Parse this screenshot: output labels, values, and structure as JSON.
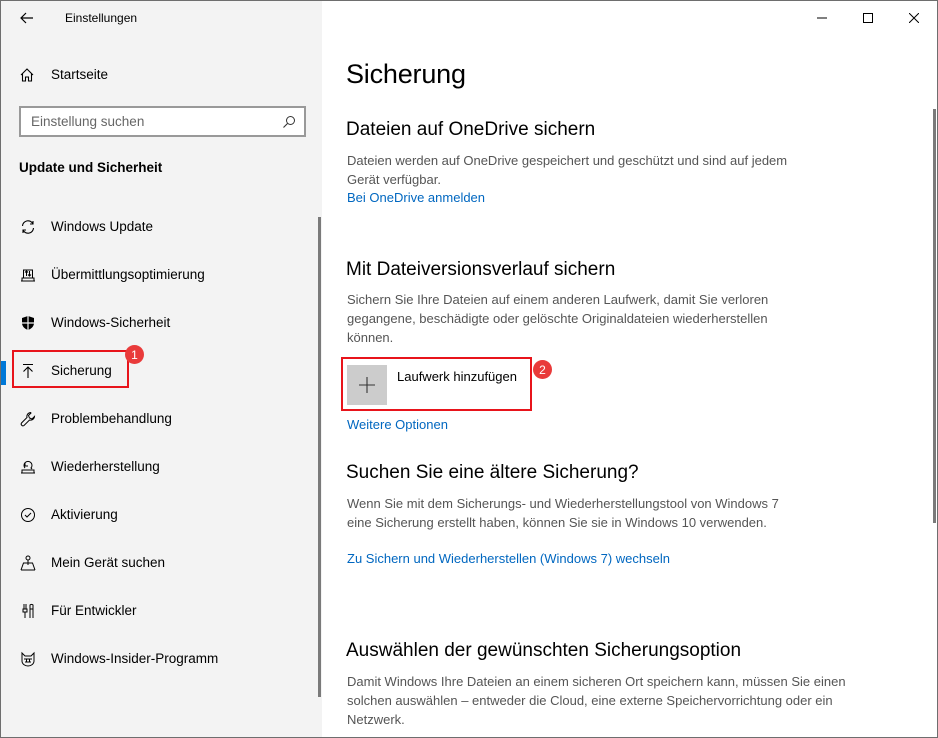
{
  "window": {
    "title": "Einstellungen",
    "controls": {
      "minimize_icon": "minimize-icon",
      "maximize_icon": "maximize-icon",
      "close_icon": "close-icon"
    }
  },
  "sidebar": {
    "back_icon": "back-arrow-icon",
    "home": {
      "label": "Startseite",
      "icon": "home-icon"
    },
    "search": {
      "placeholder": "Einstellung suchen",
      "value": "",
      "icon": "search-icon"
    },
    "section_title": "Update und Sicherheit",
    "items": [
      {
        "label": "Windows Update",
        "icon": "sync-icon",
        "active": false
      },
      {
        "label": "Übermittlungsoptimierung",
        "icon": "delivery-optimization-icon",
        "active": false
      },
      {
        "label": "Windows-Sicherheit",
        "icon": "shield-icon",
        "active": false
      },
      {
        "label": "Sicherung",
        "icon": "backup-upload-icon",
        "active": true
      },
      {
        "label": "Problembehandlung",
        "icon": "wrench-icon",
        "active": false
      },
      {
        "label": "Wiederherstellung",
        "icon": "recovery-icon",
        "active": false
      },
      {
        "label": "Aktivierung",
        "icon": "check-circle-icon",
        "active": false
      },
      {
        "label": "Mein Gerät suchen",
        "icon": "find-device-icon",
        "active": false
      },
      {
        "label": "Für Entwickler",
        "icon": "developer-tools-icon",
        "active": false
      },
      {
        "label": "Windows-Insider-Programm",
        "icon": "insider-cat-icon",
        "active": false
      }
    ]
  },
  "main": {
    "title": "Sicherung",
    "sections": [
      {
        "heading": "Dateien auf OneDrive sichern",
        "description": "Dateien werden auf OneDrive gespeichert und geschützt und sind auf jedem Gerät verfügbar.",
        "link": "Bei OneDrive anmelden"
      },
      {
        "heading": "Mit Dateiversionsverlauf sichern",
        "description": "Sichern Sie Ihre Dateien auf einem anderen Laufwerk, damit Sie verloren gegangene, beschädigte oder gelöschte Originaldateien wiederherstellen können.",
        "add_drive_label": "Laufwerk hinzufügen",
        "link": "Weitere Optionen"
      },
      {
        "heading": "Suchen Sie eine ältere Sicherung?",
        "description": "Wenn Sie mit dem Sicherungs- und Wiederherstellungstool von Windows 7 eine Sicherung erstellt haben, können Sie sie in Windows 10 verwenden.",
        "link": "Zu Sichern und Wiederherstellen (Windows 7) wechseln"
      },
      {
        "heading": "Auswählen der gewünschten Sicherungsoption",
        "description": "Damit Windows Ihre Dateien an einem sicheren Ort speichern kann, müssen Sie einen solchen auswählen – entweder die Cloud, eine externe Speichervorrichtung oder ein Netzwerk."
      }
    ]
  },
  "annotations": [
    {
      "number": "1",
      "target": "Sicherung"
    },
    {
      "number": "2",
      "target": "Laufwerk hinzufügen"
    }
  ],
  "colors": {
    "accent": "#0078d7",
    "link": "#0067c0",
    "annotation_red": "#e8141b",
    "sidebar_bg": "#f3f3f3"
  }
}
